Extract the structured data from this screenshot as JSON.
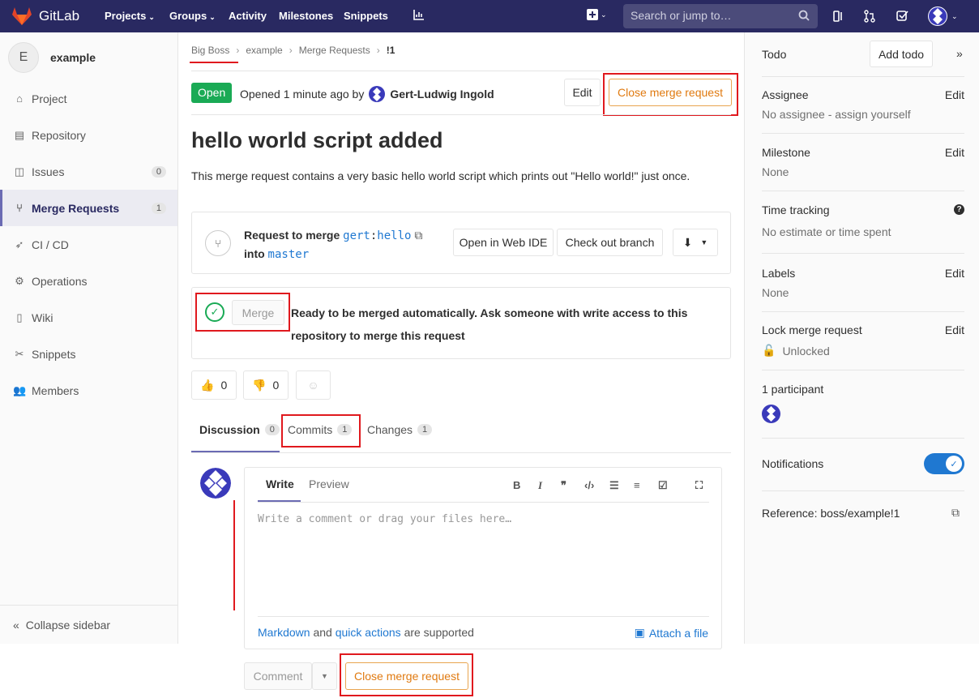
{
  "nav": {
    "logo_text": "GitLab",
    "items": [
      {
        "label": "Projects",
        "has_menu": true
      },
      {
        "label": "Groups",
        "has_menu": true
      },
      {
        "label": "Activity",
        "has_menu": false
      },
      {
        "label": "Milestones",
        "has_menu": false
      },
      {
        "label": "Snippets",
        "has_menu": false
      }
    ],
    "search_placeholder": "Search or jump to…"
  },
  "sidebar": {
    "project_initial": "E",
    "project_name": "example",
    "items": [
      {
        "label": "Project",
        "icon": "home-icon"
      },
      {
        "label": "Repository",
        "icon": "doc-icon"
      },
      {
        "label": "Issues",
        "icon": "issues-icon",
        "count": "0"
      },
      {
        "label": "Merge Requests",
        "icon": "merge-request-icon",
        "count": "1",
        "active": true
      },
      {
        "label": "CI / CD",
        "icon": "rocket-icon"
      },
      {
        "label": "Operations",
        "icon": "cloud-gear-icon"
      },
      {
        "label": "Wiki",
        "icon": "book-icon"
      },
      {
        "label": "Snippets",
        "icon": "scissors-icon"
      },
      {
        "label": "Members",
        "icon": "users-icon"
      }
    ],
    "collapse_label": "Collapse sidebar"
  },
  "breadcrumb": [
    "Big Boss",
    "example",
    "Merge Requests",
    "!1"
  ],
  "mr": {
    "status": "Open",
    "opened_text": "Opened 1 minute ago by",
    "author": "Gert-Ludwig Ingold",
    "edit_label": "Edit",
    "close_label": "Close merge request",
    "title": "hello world script added",
    "description": "This merge request contains a very basic hello world script which prints out \"Hello world!\" just once.",
    "request_to_merge": "Request to merge",
    "source_user": "gert",
    "source_branch": "hello",
    "into": "into",
    "target_branch": "master",
    "open_web_ide": "Open in Web IDE",
    "checkout_branch": "Check out branch",
    "merge_button": "Merge",
    "ready_text": "Ready to be merged automatically. Ask someone with write access to this repository to merge this request",
    "thumbs_up_count": "0",
    "thumbs_down_count": "0"
  },
  "tabs": [
    {
      "label": "Discussion",
      "count": "0",
      "active": true
    },
    {
      "label": "Commits",
      "count": "1"
    },
    {
      "label": "Changes",
      "count": "1"
    }
  ],
  "editor": {
    "write_tab": "Write",
    "preview_tab": "Preview",
    "placeholder": "Write a comment or drag your files here…",
    "markdown_link": "Markdown",
    "and_text": "and",
    "quick_actions_link": "quick actions",
    "supported_text": "are supported",
    "attach_label": "Attach a file",
    "comment_button": "Comment",
    "close_button": "Close merge request"
  },
  "right_sidebar": {
    "todo_label": "Todo",
    "add_todo": "Add todo",
    "assignee_label": "Assignee",
    "assignee_value": "No assignee - assign yourself",
    "milestone_label": "Milestone",
    "milestone_value": "None",
    "time_tracking_label": "Time tracking",
    "time_tracking_value": "No estimate or time spent",
    "labels_label": "Labels",
    "labels_value": "None",
    "lock_label": "Lock merge request",
    "lock_value": "Unlocked",
    "participants_label": "1 participant",
    "notifications_label": "Notifications",
    "notifications_on": true,
    "reference": "Reference: boss/example!1",
    "edit_label": "Edit"
  },
  "colors": {
    "nav_bg": "#292961",
    "open_badge": "#1aaa55",
    "link": "#1f78d1",
    "warning": "#e07a10",
    "highlight_box": "#e0191e"
  }
}
